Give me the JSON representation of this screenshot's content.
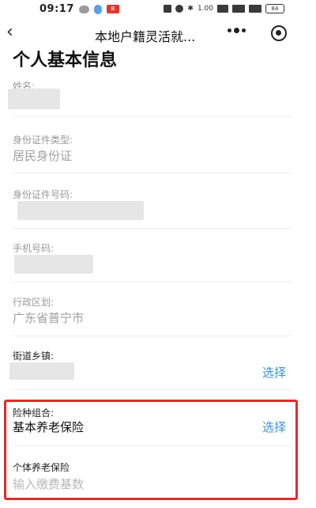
{
  "status_bar": {
    "time": "09:17",
    "red_badge": "B",
    "signal_text": "1.00",
    "battery": "84"
  },
  "nav": {
    "title": "本地户籍灵活就..."
  },
  "page": {
    "title": "个人基本信息"
  },
  "fields": {
    "name_label": "姓名:",
    "id_type_label": "身份证件类型:",
    "id_type_value": "居民身份证",
    "id_number_label": "身份证件号码:",
    "phone_label": "手机号码:",
    "region_label": "行政区划:",
    "region_value": "广东省普宁市",
    "street_label": "街道乡镇:",
    "street_select": "选择"
  },
  "insurance": {
    "combo_label": "险种组合:",
    "combo_value": "基本养老保险",
    "combo_select": "选择",
    "pension_label": "个体养老保险",
    "pension_placeholder": "输入缴费基数"
  }
}
